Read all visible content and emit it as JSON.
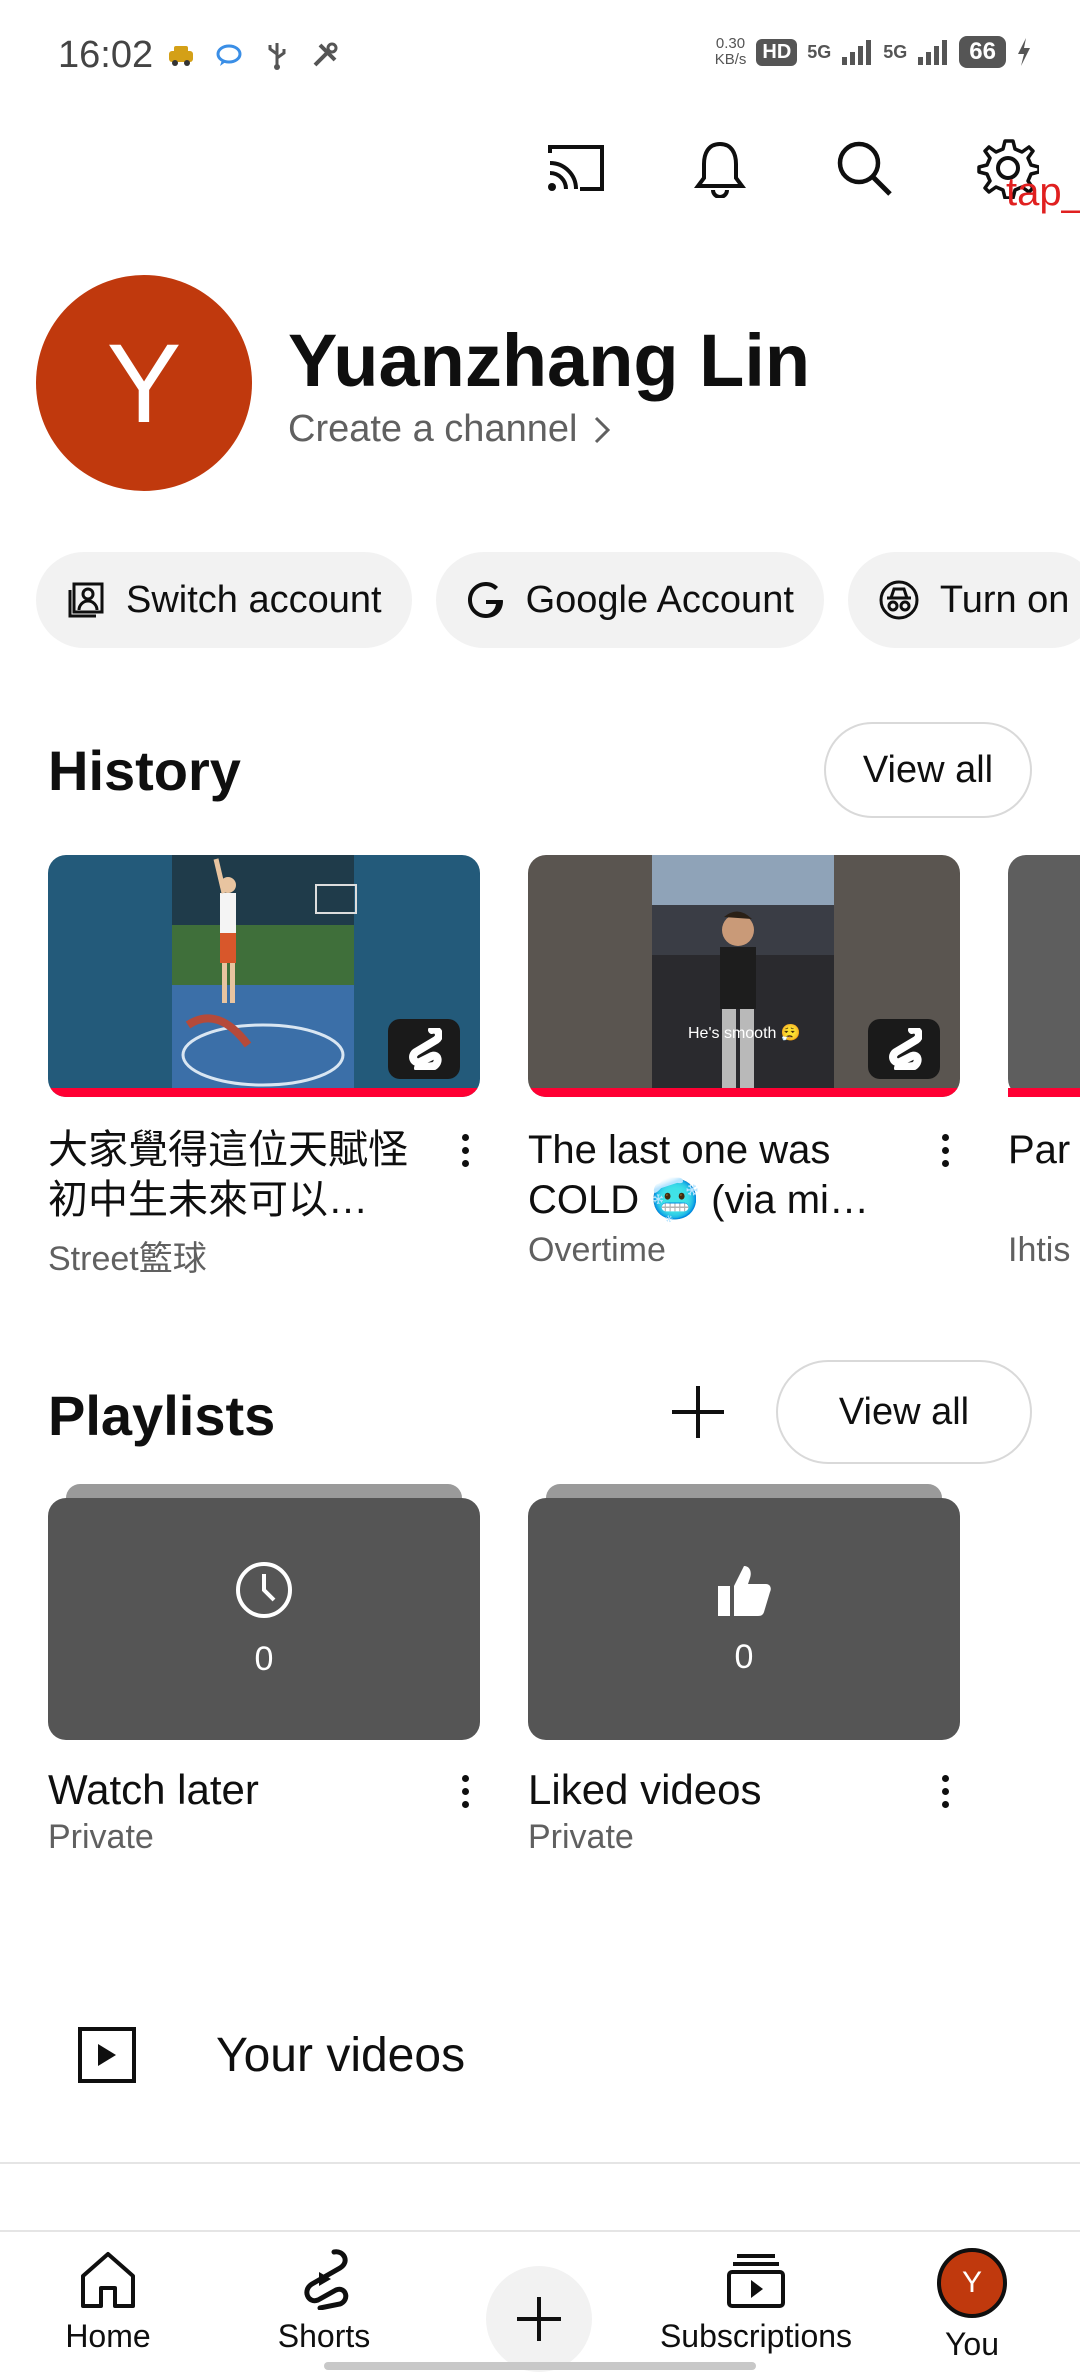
{
  "status_bar": {
    "time": "16:02",
    "net_speed_value": "0.30",
    "net_speed_unit": "KB/s",
    "hd_badge": "HD",
    "sim1": "5G",
    "sim2": "5G",
    "battery": "66"
  },
  "top_actions": {
    "cast": "cast-icon",
    "notifications": "bell-icon",
    "search": "search-icon",
    "settings": "gear-icon",
    "overlay_label": "tap_"
  },
  "profile": {
    "avatar_letter": "Y",
    "avatar_color": "#c0390d",
    "name": "Yuanzhang Lin",
    "create_channel": "Create a channel"
  },
  "chips": [
    {
      "label": "Switch account",
      "icon": "switch-account-icon"
    },
    {
      "label": "Google Account",
      "icon": "google-g-icon"
    },
    {
      "label": "Turn on",
      "icon": "incognito-icon"
    }
  ],
  "history": {
    "title": "History",
    "view_all": "View all",
    "items": [
      {
        "title": "大家覺得這位天賦怪初中生未來可以…",
        "channel": "Street籃球",
        "shorts": true
      },
      {
        "title": "The last one was COLD 🥶 (via mi…",
        "channel": "Overtime",
        "shorts": true,
        "overlay_caption": "He's smooth 😮‍💨"
      },
      {
        "title": "Par Pov",
        "channel": "Ihtis",
        "shorts": false
      }
    ]
  },
  "playlists": {
    "title": "Playlists",
    "view_all": "View all",
    "items": [
      {
        "title": "Watch later",
        "privacy": "Private",
        "count": "0",
        "icon": "clock-icon"
      },
      {
        "title": "Liked videos",
        "privacy": "Private",
        "count": "0",
        "icon": "thumbs-up-icon"
      }
    ]
  },
  "your_videos": {
    "label": "Your videos"
  },
  "bottom_nav": {
    "home": "Home",
    "shorts": "Shorts",
    "subscriptions": "Subscriptions",
    "you": "You",
    "you_avatar_letter": "Y"
  },
  "colors": {
    "progress": "#ff0033",
    "avatar": "#c0390d",
    "overlay_text": "#e02020"
  }
}
